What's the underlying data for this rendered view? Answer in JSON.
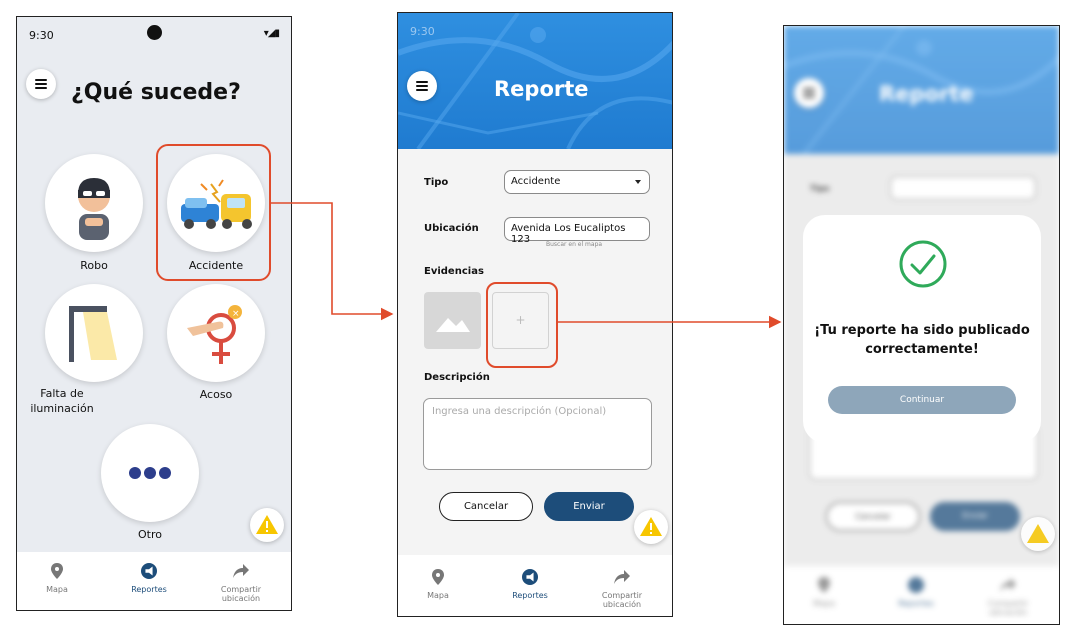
{
  "status": {
    "time": "9:30"
  },
  "screen1": {
    "title": "¿Qué sucede?",
    "options": [
      {
        "label": "Robo"
      },
      {
        "label": "Accidente"
      },
      {
        "label": "Falta de iluminación"
      },
      {
        "label": "Acoso"
      },
      {
        "label": "Otro"
      }
    ]
  },
  "screen2": {
    "title": "Reporte",
    "tipo_label": "Tipo",
    "tipo_value": "Accidente",
    "ubicacion_label": "Ubicación",
    "ubicacion_value": "Avenida Los Eucaliptos 123",
    "map_link": "Buscar en el mapa",
    "evidencias_label": "Evidencias",
    "add_symbol": "+",
    "descripcion_label": "Descripción",
    "descripcion_placeholder": "Ingresa una descripción (Opcional)",
    "cancel_label": "Cancelar",
    "send_label": "Enviar"
  },
  "screen3": {
    "title": "Reporte",
    "tipo_label": "Tipo",
    "message_line1": "¡Tu reporte ha sido publicado",
    "message_line2": "correctamente!",
    "continue_label": "Continuar",
    "cancel_label": "Cancelar",
    "send_label": "Enviar"
  },
  "nav": {
    "map": "Mapa",
    "reports": "Reportes",
    "share_line1": "Compartir",
    "share_line2": "ubicación"
  },
  "colors": {
    "accent": "#1d4d7a",
    "highlight": "#e04b2b",
    "header_blue": "#2b87d9",
    "success": "#2faa5a",
    "warning": "#f7c600"
  },
  "icons": [
    "menu-icon",
    "robber-icon",
    "car-crash-icon",
    "street-lamp-icon",
    "harassment-icon",
    "more-dots-icon",
    "warning-icon",
    "map-pin-icon",
    "megaphone-icon",
    "share-arrow-icon",
    "image-icon",
    "check-circle-icon"
  ]
}
